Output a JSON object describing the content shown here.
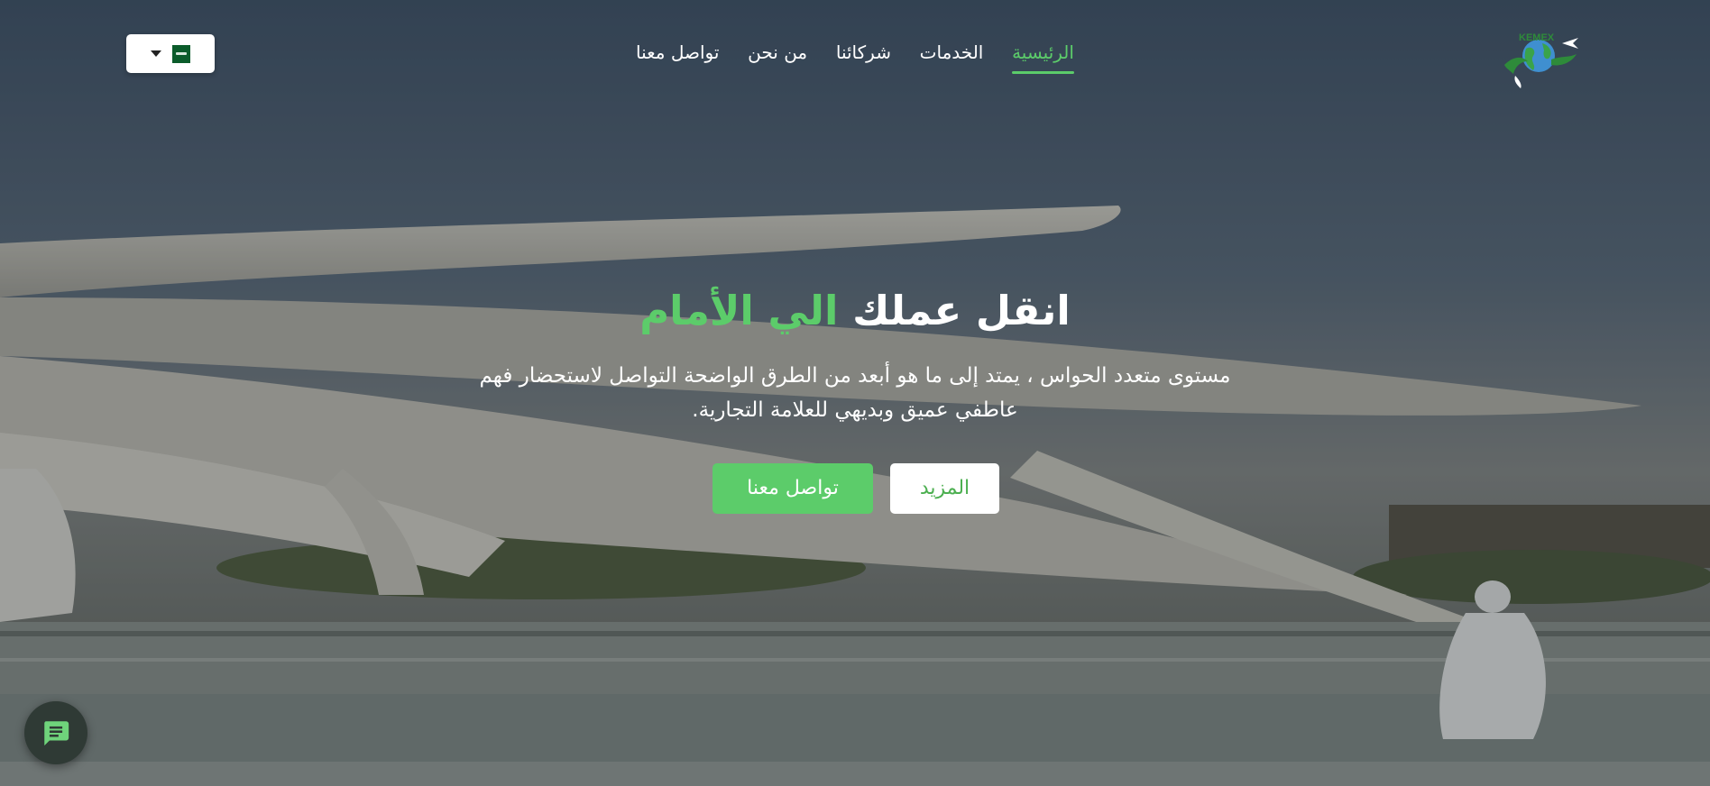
{
  "header": {
    "language": {
      "flag": "saudi-arabia-flag-icon",
      "caret": "caret-down-icon"
    },
    "nav": [
      {
        "label": "الرئيسية",
        "active": true
      },
      {
        "label": "الخدمات",
        "active": false
      },
      {
        "label": "شركائنا",
        "active": false
      },
      {
        "label": "من نحن",
        "active": false
      },
      {
        "label": "تواصل معنا",
        "active": false
      }
    ],
    "logo": {
      "text": "KEMEX",
      "icon": "globe-plane-logo"
    }
  },
  "hero": {
    "title_main": "انقل عملك",
    "title_accent": "الي الأمام",
    "subtitle": "مستوى متعدد الحواس ، يمتد إلى ما هو أبعد من الطرق الواضحة التواصل لاستحضار فهم عاطفي عميق وبديهي للعلامة التجارية.",
    "primary_button": "تواصل معنا",
    "secondary_button": "المزيد"
  },
  "chat": {
    "icon": "chat-bubble-icon"
  },
  "colors": {
    "accent": "#5ccc6a",
    "white": "#ffffff",
    "chat_bg": "#2f3a35"
  }
}
